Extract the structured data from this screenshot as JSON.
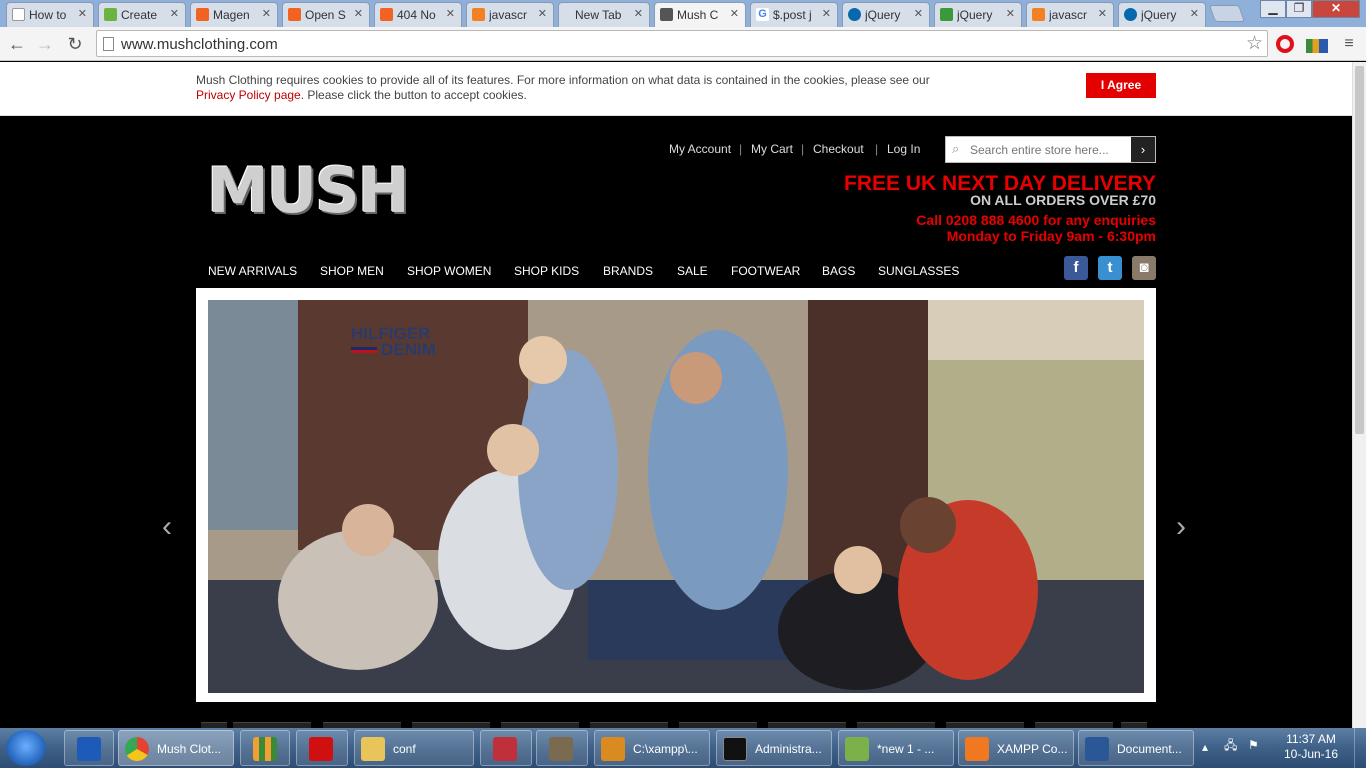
{
  "browser": {
    "tabs": [
      {
        "title": "How to",
        "icon_color": "#ffffff"
      },
      {
        "title": "Create",
        "icon_color": "#6db33f"
      },
      {
        "title": "Magen",
        "icon_color": "#f26322"
      },
      {
        "title": "Open S",
        "icon_color": "#f26322"
      },
      {
        "title": "404 No",
        "icon_color": "#f26322"
      },
      {
        "title": "javascr",
        "icon_color": "#f48024"
      },
      {
        "title": "New Tab",
        "icon_color": "#d6deea"
      },
      {
        "title": "Mush C",
        "icon_color": "#555555"
      },
      {
        "title": "$.post j",
        "icon_color": "#4285f4"
      },
      {
        "title": "jQuery",
        "icon_color": "#0769ad"
      },
      {
        "title": "jQuery",
        "icon_color": "#3a9a3a"
      },
      {
        "title": "javascr",
        "icon_color": "#f48024"
      },
      {
        "title": "jQuery",
        "icon_color": "#0769ad"
      }
    ],
    "url": "www.mushclothing.com"
  },
  "cookie_banner": {
    "message_part1": "Mush Clothing requires cookies to provide all of its features. For more information on what data is contained in the cookies, please see our",
    "privacy_link": "Privacy Policy page",
    "message_part2": ". Please click the button to accept cookies.",
    "agree_label": "I Agree"
  },
  "header": {
    "links": [
      "My Account",
      "My Cart",
      "Checkout",
      "Log In"
    ],
    "search_placeholder": "Search entire store here...",
    "logo_text": "MUSH",
    "promo_headline": "FREE UK NEXT DAY DELIVERY",
    "promo_sub": "ON ALL ORDERS OVER £70",
    "phone_line": "Call 0208 888 4600 for any enquiries",
    "hours_line": "Monday to Friday 9am - 6:30pm"
  },
  "nav": {
    "items": [
      "NEW ARRIVALS",
      "SHOP MEN",
      "SHOP WOMEN",
      "SHOP KIDS",
      "BRANDS",
      "SALE",
      "FOOTWEAR",
      "BAGS",
      "SUNGLASSES"
    ]
  },
  "social": [
    {
      "name": "facebook",
      "glyph": "f",
      "color": "#3b5998"
    },
    {
      "name": "twitter",
      "glyph": "t",
      "color": "#3a8fd0"
    },
    {
      "name": "instagram",
      "glyph": "◙",
      "color": "#8a7a6a"
    }
  ],
  "hero": {
    "brand_badge_line1": "HILFIGER",
    "brand_badge_line2": "DENIM",
    "prev_glyph": "‹",
    "next_glyph": "›"
  },
  "taskbar": {
    "items": [
      {
        "label": "",
        "icon_color": "#1e5bb8"
      },
      {
        "label": "Mush Clot...",
        "icon_color": "#e34234"
      },
      {
        "label": "",
        "icon_color": "#f0a030"
      },
      {
        "label": "",
        "icon_color": "#d01010"
      },
      {
        "label": "conf",
        "icon_color": "#e8c45a"
      },
      {
        "label": "",
        "icon_color": "#c0303a"
      },
      {
        "label": "",
        "icon_color": "#7a6a50"
      },
      {
        "label": "C:\\xampp\\...",
        "icon_color": "#d98b20"
      },
      {
        "label": "Administra...",
        "icon_color": "#111111"
      },
      {
        "label": "*new 1 - ...",
        "icon_color": "#7bb04a"
      },
      {
        "label": "XAMPP Co...",
        "icon_color": "#f07820"
      },
      {
        "label": "Document...",
        "icon_color": "#2b5797"
      }
    ],
    "time": "11:37 AM",
    "date": "10-Jun-16"
  }
}
